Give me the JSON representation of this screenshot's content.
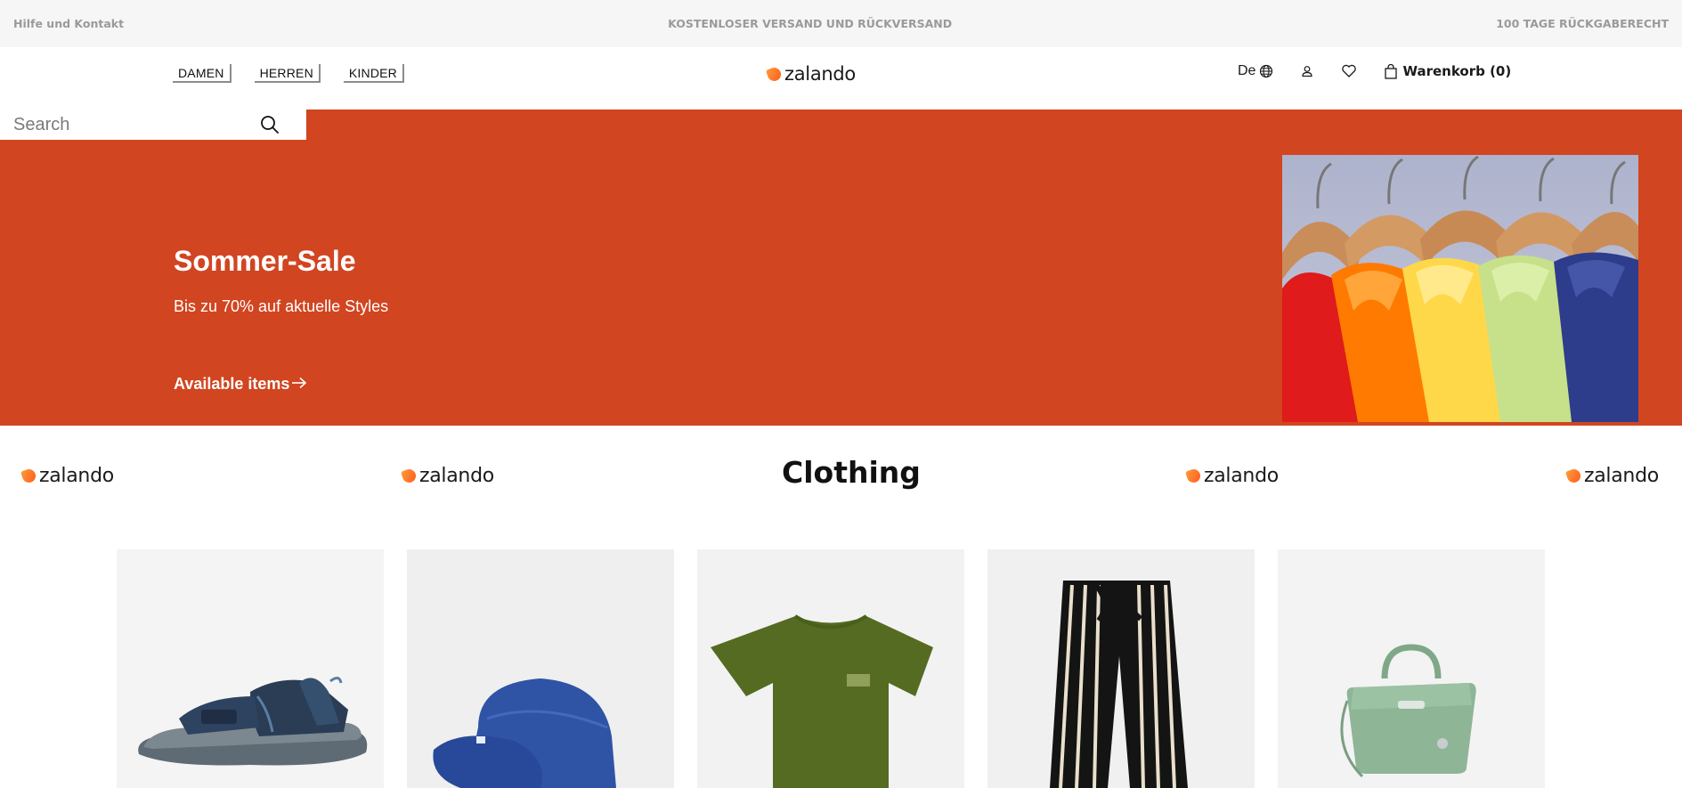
{
  "topbar": {
    "help": "Hilfe und Kontakt",
    "shipping": "KOSTENLOSER VERSAND UND RÜCKVERSAND",
    "returns": "100 TAGE RÜCKGABERECHT"
  },
  "header": {
    "nav": [
      {
        "label": "DAMEN"
      },
      {
        "label": "HERREN"
      },
      {
        "label": "KINDER"
      }
    ],
    "logo_text": "zalando",
    "language": "De",
    "cart_label": "Warenkorb (0)",
    "icons": [
      "globe-icon",
      "user-icon",
      "heart-icon",
      "shopping-bag-icon"
    ]
  },
  "search": {
    "placeholder": "Search",
    "value": ""
  },
  "hero": {
    "title": "Sommer-Sale",
    "subtitle": "Bis zu 70% auf aktuelle Styles",
    "link": "Available items",
    "background": "#d14520",
    "image": "colorful-shirts-on-hangers"
  },
  "brand_strip": {
    "logo_text": "zalando",
    "title": "Clothing"
  },
  "products": [
    {
      "image": "kids-sandal"
    },
    {
      "image": "sun-cap"
    },
    {
      "image": "green-t-shirt"
    },
    {
      "image": "striped-trousers"
    },
    {
      "image": "green-handbag"
    }
  ],
  "colors": {
    "accent": "#d14520",
    "logo_orange": "#ff6900",
    "topbar_bg": "#f6f6f6",
    "card_bg": "#f2f2f2"
  }
}
